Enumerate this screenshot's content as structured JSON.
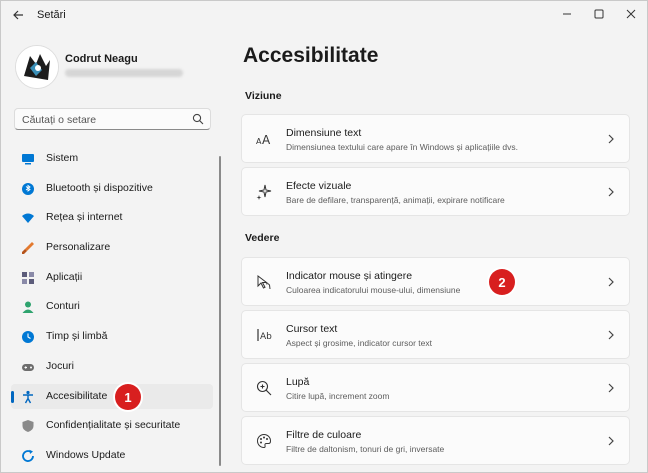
{
  "app": {
    "title": "Setări",
    "back_icon": "back-arrow-icon"
  },
  "profile": {
    "name": "Codrut Neagu"
  },
  "search": {
    "placeholder": "Căutați o setare"
  },
  "sidebar": {
    "items": [
      {
        "label": "Sistem",
        "icon": "system-icon",
        "color": "#0078d4"
      },
      {
        "label": "Bluetooth și dispozitive",
        "icon": "bluetooth-icon",
        "color": "#0078d4"
      },
      {
        "label": "Rețea și internet",
        "icon": "network-icon",
        "color": "#0078d4"
      },
      {
        "label": "Personalizare",
        "icon": "brush-icon",
        "color": "#e3792e"
      },
      {
        "label": "Aplicații",
        "icon": "apps-icon",
        "color": "#5c5c7a"
      },
      {
        "label": "Conturi",
        "icon": "accounts-icon",
        "color": "#2ea36e"
      },
      {
        "label": "Timp și limbă",
        "icon": "clock-globe-icon",
        "color": "#0078d4"
      },
      {
        "label": "Jocuri",
        "icon": "gamepad-icon",
        "color": "#6d6d6d"
      },
      {
        "label": "Accesibilitate",
        "icon": "accessibility-icon",
        "color": "#0067c0",
        "active": true
      },
      {
        "label": "Confidențialitate și securitate",
        "icon": "shield-icon",
        "color": "#7a7a7a"
      },
      {
        "label": "Windows Update",
        "icon": "update-icon",
        "color": "#0078d4"
      }
    ]
  },
  "main": {
    "title": "Accesibilitate",
    "sections": [
      {
        "title": "Viziune",
        "cards": [
          {
            "title": "Dimensiune text",
            "desc": "Dimensiunea textului care apare în Windows și aplicațiile dvs.",
            "icon": "text-size-icon"
          },
          {
            "title": "Efecte vizuale",
            "desc": "Bare de defilare, transparență, animații, expirare notificare",
            "icon": "sparkle-icon"
          }
        ]
      },
      {
        "title": "Vedere",
        "cards": [
          {
            "title": "Indicator mouse și atingere",
            "desc": "Culoarea indicatorului mouse-ului, dimensiune",
            "icon": "mouse-pointer-icon"
          },
          {
            "title": "Cursor text",
            "desc": "Aspect și grosime, indicator cursor text",
            "icon": "text-cursor-icon"
          },
          {
            "title": "Lupă",
            "desc": "Citire lupă, increment zoom",
            "icon": "magnifier-icon"
          },
          {
            "title": "Filtre de culoare",
            "desc": "Filtre de daltonism, tonuri de gri, inversate",
            "icon": "palette-icon"
          }
        ]
      }
    ]
  },
  "annotations": [
    {
      "label": "1",
      "color": "#d81f1f"
    },
    {
      "label": "2",
      "color": "#d81f1f"
    }
  ]
}
